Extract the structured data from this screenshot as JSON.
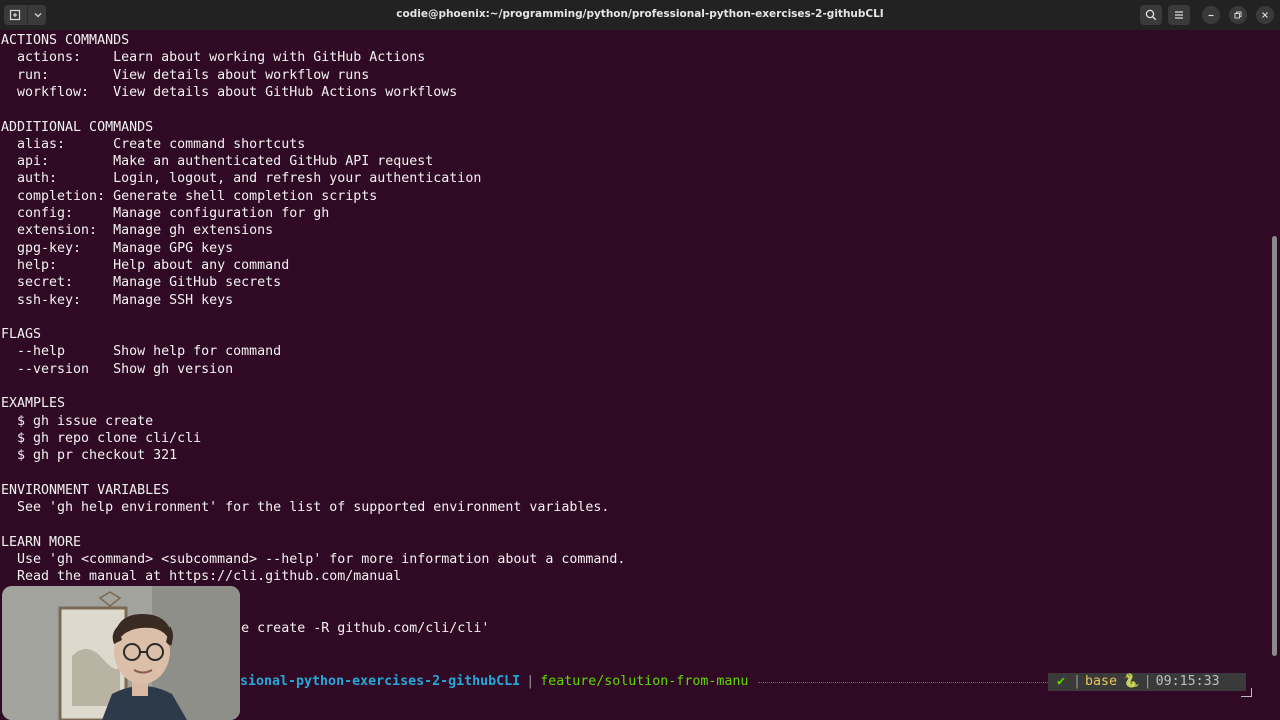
{
  "window": {
    "title": "codie@phoenix:~/programming/python/professional-python-exercises-2-githubCLI"
  },
  "terminal": {
    "lines": [
      "ACTIONS COMMANDS",
      "  actions:    Learn about working with GitHub Actions",
      "  run:        View details about workflow runs",
      "  workflow:   View details about GitHub Actions workflows",
      "",
      "ADDITIONAL COMMANDS",
      "  alias:      Create command shortcuts",
      "  api:        Make an authenticated GitHub API request",
      "  auth:       Login, logout, and refresh your authentication",
      "  completion: Generate shell completion scripts",
      "  config:     Manage configuration for gh",
      "  extension:  Manage gh extensions",
      "  gpg-key:    Manage GPG keys",
      "  help:       Help about any command",
      "  secret:     Manage GitHub secrets",
      "  ssh-key:    Manage SSH keys",
      "",
      "FLAGS",
      "  --help      Show help for command",
      "  --version   Show gh version",
      "",
      "EXAMPLES",
      "  $ gh issue create",
      "  $ gh repo clone cli/cli",
      "  $ gh pr checkout 321",
      "",
      "ENVIRONMENT VARIABLES",
      "  See 'gh help environment' for the list of supported environment variables.",
      "",
      "LEARN MORE",
      "  Use 'gh <command> <subcommand> --help' for more information about a command.",
      "  Read the manual at https://cli.github.com/manual",
      "",
      "",
      "                              e create -R github.com/cli/cli'"
    ]
  },
  "prompt": {
    "path": "sional-python-exercises-2-githubCLI",
    "separator": "|",
    "branch": "feature/solution-from-manu",
    "status_icon": "✔",
    "env": "base",
    "env_icon": "🐍",
    "time": "09:15:33"
  },
  "icons": {
    "new_tab": "new-tab-icon",
    "tab_menu": "chevron-down-icon",
    "search": "search-icon",
    "menu": "hamburger-menu-icon",
    "minimize": "minimize-icon",
    "maximize": "maximize-icon",
    "close": "close-icon"
  },
  "colors": {
    "terminal_bg": "#300a24",
    "terminal_fg": "#f2f2f2",
    "titlebar_bg": "#222222",
    "prompt_path": "#27a7d8",
    "prompt_branch": "#5fd700",
    "status_ok": "#5fd700",
    "env_name": "#e8c75a"
  }
}
